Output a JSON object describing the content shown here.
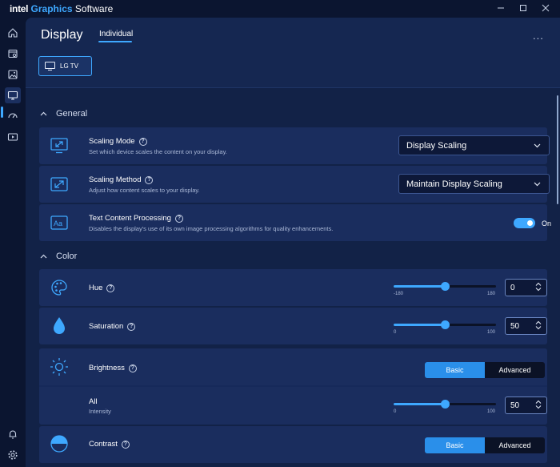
{
  "app": {
    "brand_intel": "intel",
    "brand_graphics": "Graphics",
    "brand_software": "Software"
  },
  "header": {
    "title": "Display",
    "tab": "Individual",
    "more": "..."
  },
  "device": {
    "label": "LG TV"
  },
  "sections": {
    "general": "General",
    "color": "Color"
  },
  "scaling_mode": {
    "title": "Scaling Mode",
    "desc": "Set which device scales the content on your display.",
    "value": "Display Scaling"
  },
  "scaling_method": {
    "title": "Scaling Method",
    "desc": "Adjust how content scales to your display.",
    "value": "Maintain Display Scaling"
  },
  "text_processing": {
    "title": "Text Content Processing",
    "desc": "Disables the display's use of its own image processing algorithms for quality enhancements.",
    "state": "On"
  },
  "hue": {
    "title": "Hue",
    "min": "-180",
    "max": "180",
    "value": "0",
    "fraction": 0.5
  },
  "saturation": {
    "title": "Saturation",
    "min": "0",
    "max": "100",
    "value": "50",
    "fraction": 0.5
  },
  "brightness": {
    "title": "Brightness",
    "basic": "Basic",
    "advanced": "Advanced",
    "all": {
      "title": "All",
      "subtitle": "Intensity",
      "min": "0",
      "max": "100",
      "value": "50",
      "fraction": 0.5
    }
  },
  "contrast": {
    "title": "Contrast",
    "basic": "Basic",
    "advanced": "Advanced"
  },
  "colors": {
    "accent": "#3ea8ff",
    "background": "#0b1530",
    "panel": "#122247",
    "card": "#1a2d5e"
  }
}
